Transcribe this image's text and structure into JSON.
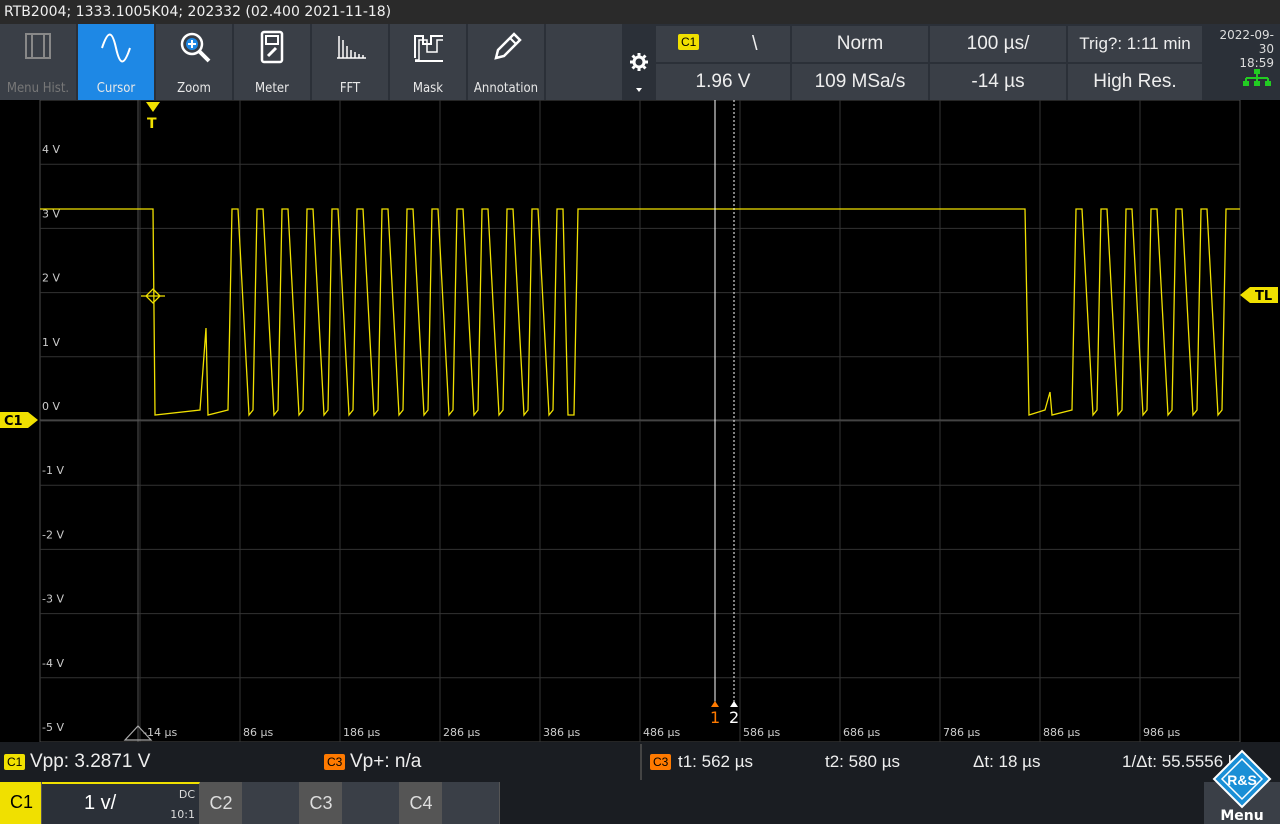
{
  "title_bar": "RTB2004; 1333.1005K04; 202332 (02.400 2021-11-18)",
  "toolbar": {
    "tools": [
      {
        "label": "Menu Hist.",
        "icon": "menu-history-icon",
        "active": false,
        "disabled": true
      },
      {
        "label": "Cursor",
        "icon": "cursor-sine-icon",
        "active": true,
        "disabled": false
      },
      {
        "label": "Zoom",
        "icon": "zoom-magnifier-icon",
        "active": false,
        "disabled": false
      },
      {
        "label": "Meter",
        "icon": "meter-icon",
        "active": false,
        "disabled": false
      },
      {
        "label": "FFT",
        "icon": "fft-spectrum-icon",
        "active": false,
        "disabled": false
      },
      {
        "label": "Mask",
        "icon": "mask-icon",
        "active": false,
        "disabled": false
      },
      {
        "label": "Annotation",
        "icon": "annotation-pen-icon",
        "active": false,
        "disabled": false
      }
    ],
    "settings_icon": "gear-icon"
  },
  "trigger_info": {
    "source": "C1",
    "slope_symbol": "\\",
    "mode": "Norm",
    "timebase": "100 µs/",
    "trig_status": "Trig?: 1:11 min",
    "level": "1.96 V",
    "sample_rate": "109 MSa/s",
    "position": "-14 µs",
    "acq_mode": "High Res."
  },
  "datetime": {
    "date": "2022-09-30",
    "time": "18:59"
  },
  "scope": {
    "y_labels": [
      "4 V",
      "3 V",
      "2 V",
      "1 V",
      "0 V",
      "-1 V",
      "-2 V",
      "-3 V",
      "-4 V",
      "-5 V"
    ],
    "x_labels": [
      "-14 µs",
      "86 µs",
      "186 µs",
      "286 µs",
      "386 µs",
      "486 µs",
      "586 µs",
      "686 µs",
      "786 µs",
      "886 µs",
      "986 µs"
    ],
    "trigger_marker": "T",
    "trigger_level_marker": "TL",
    "channel_marker": "C1",
    "cursor1_label": "1",
    "cursor2_label": "2",
    "colors": {
      "trace": "#f0e000",
      "grid": "#3a3a3a",
      "cursor": "#ffffff",
      "cursor1": "#ff7a00"
    }
  },
  "measurements": {
    "m1_source": "C1",
    "m1_text": "Vpp: 3.2871 V",
    "m2_source": "C3",
    "m2_text": "Vp+: n/a",
    "cursor_source": "C3",
    "t1": "t1: 562 µs",
    "t2": "t2: 580 µs",
    "dt": "Δt: 18 µs",
    "inv_dt": "1/Δt: 55.5556 k"
  },
  "channels": [
    {
      "name": "C1",
      "scale": "1 v/",
      "coupling": "DC",
      "probe": "10:1",
      "active": true
    },
    {
      "name": "C2",
      "active": false
    },
    {
      "name": "C3",
      "active": false
    },
    {
      "name": "C4",
      "active": false
    }
  ],
  "menu_label": "Menu",
  "logo_text": "R&S"
}
